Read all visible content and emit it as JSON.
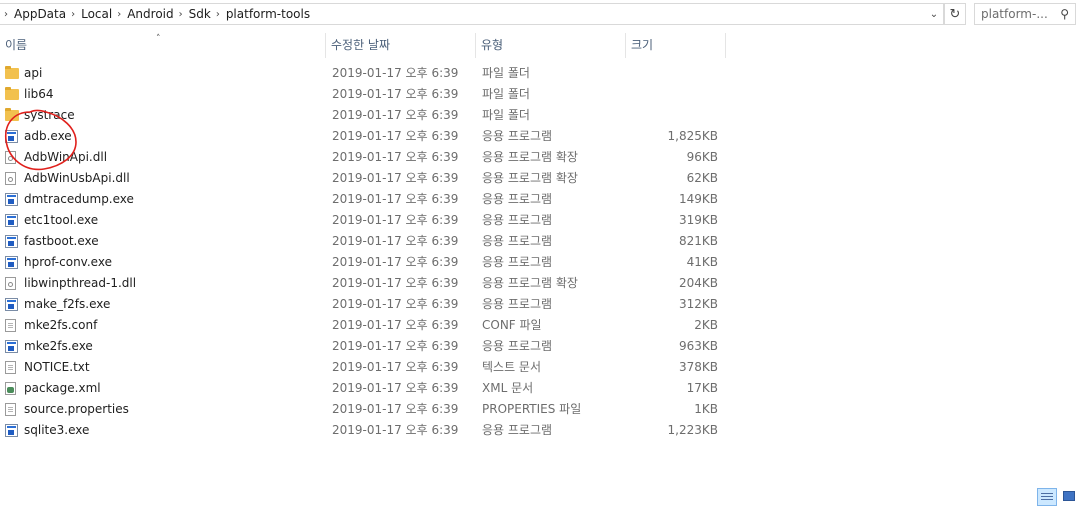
{
  "address": {
    "crumbs": [
      "AppData",
      "Local",
      "Android",
      "Sdk",
      "platform-tools"
    ],
    "dropdown_icon": "chevron-down-icon",
    "refresh_icon": "refresh-icon"
  },
  "search": {
    "placeholder": "platform-...",
    "icon": "search-icon"
  },
  "columns": {
    "name": "이름",
    "date": "수정한 날짜",
    "type": "유형",
    "size": "크기"
  },
  "files": [
    {
      "name": "api",
      "date": "2019-01-17 오후 6:39",
      "type": "파일 폴더",
      "size": "",
      "icon": "folder-icon"
    },
    {
      "name": "lib64",
      "date": "2019-01-17 오후 6:39",
      "type": "파일 폴더",
      "size": "",
      "icon": "folder-icon"
    },
    {
      "name": "systrace",
      "date": "2019-01-17 오후 6:39",
      "type": "파일 폴더",
      "size": "",
      "icon": "folder-icon"
    },
    {
      "name": "adb.exe",
      "date": "2019-01-17 오후 6:39",
      "type": "응용 프로그램",
      "size": "1,825KB",
      "icon": "exe-icon"
    },
    {
      "name": "AdbWinApi.dll",
      "date": "2019-01-17 오후 6:39",
      "type": "응용 프로그램 확장",
      "size": "96KB",
      "icon": "dll-icon"
    },
    {
      "name": "AdbWinUsbApi.dll",
      "date": "2019-01-17 오후 6:39",
      "type": "응용 프로그램 확장",
      "size": "62KB",
      "icon": "dll-icon"
    },
    {
      "name": "dmtracedump.exe",
      "date": "2019-01-17 오후 6:39",
      "type": "응용 프로그램",
      "size": "149KB",
      "icon": "exe-icon"
    },
    {
      "name": "etc1tool.exe",
      "date": "2019-01-17 오후 6:39",
      "type": "응용 프로그램",
      "size": "319KB",
      "icon": "exe-icon"
    },
    {
      "name": "fastboot.exe",
      "date": "2019-01-17 오후 6:39",
      "type": "응용 프로그램",
      "size": "821KB",
      "icon": "exe-icon"
    },
    {
      "name": "hprof-conv.exe",
      "date": "2019-01-17 오후 6:39",
      "type": "응용 프로그램",
      "size": "41KB",
      "icon": "exe-icon"
    },
    {
      "name": "libwinpthread-1.dll",
      "date": "2019-01-17 오후 6:39",
      "type": "응용 프로그램 확장",
      "size": "204KB",
      "icon": "dll-icon"
    },
    {
      "name": "make_f2fs.exe",
      "date": "2019-01-17 오후 6:39",
      "type": "응용 프로그램",
      "size": "312KB",
      "icon": "exe-icon"
    },
    {
      "name": "mke2fs.conf",
      "date": "2019-01-17 오후 6:39",
      "type": "CONF 파일",
      "size": "2KB",
      "icon": "document-icon"
    },
    {
      "name": "mke2fs.exe",
      "date": "2019-01-17 오후 6:39",
      "type": "응용 프로그램",
      "size": "963KB",
      "icon": "exe-icon"
    },
    {
      "name": "NOTICE.txt",
      "date": "2019-01-17 오후 6:39",
      "type": "텍스트 문서",
      "size": "378KB",
      "icon": "text-document-icon"
    },
    {
      "name": "package.xml",
      "date": "2019-01-17 오후 6:39",
      "type": "XML 문서",
      "size": "17KB",
      "icon": "xml-icon"
    },
    {
      "name": "source.properties",
      "date": "2019-01-17 오후 6:39",
      "type": "PROPERTIES 파일",
      "size": "1KB",
      "icon": "document-icon"
    },
    {
      "name": "sqlite3.exe",
      "date": "2019-01-17 오후 6:39",
      "type": "응용 프로그램",
      "size": "1,223KB",
      "icon": "exe-icon"
    }
  ],
  "colors": {
    "annotation": "#e0201c",
    "header_text": "#4c607a",
    "selected_view": "#cce8ff"
  },
  "view_buttons": [
    "details-view-icon",
    "large-icons-view-icon"
  ]
}
